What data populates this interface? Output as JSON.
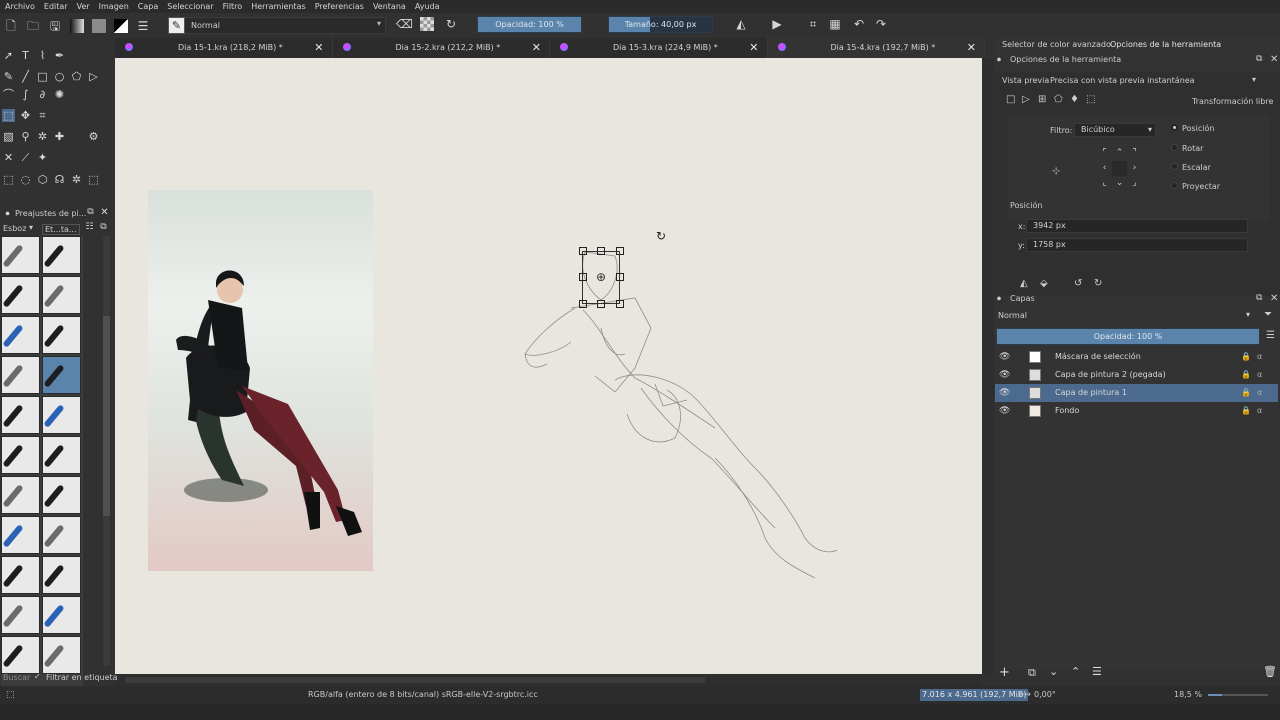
{
  "menu": [
    "Archivo",
    "Editar",
    "Ver",
    "Imagen",
    "Capa",
    "Seleccionar",
    "Filtro",
    "Herramientas",
    "Preferencias",
    "Ventana",
    "Ayuda"
  ],
  "toolbar": {
    "blend_mode": "Normal",
    "opacity_label": "Opacidad: 100 %",
    "opacity_value": 1.0,
    "size_label": "Tamaño: 40,00 px",
    "size_value": 0.4
  },
  "tabs": [
    {
      "title": "Dia 15-1.kra (218,2 MiB) *"
    },
    {
      "title": "Dia 15-2.kra (212,2 MiB) *"
    },
    {
      "title": "Dia 15-3.kra (224,9 MiB) *"
    },
    {
      "title": "Dia 15-4.kra (192,7 MiB) *"
    }
  ],
  "brush_presets": {
    "title": "Preajustes de pi...",
    "tag_value": "Esboz",
    "tag_label": "Et...ta...",
    "search_placeholder": "Buscar",
    "filter_label": "Filtrar en etiqueta"
  },
  "right": {
    "tab_color": "Selector de color avanzado",
    "tab_tool": "Opciones de la herramienta",
    "tool_options_title": "Opciones de la herramienta",
    "preview_label": "Vista previa",
    "preview_value": "Precisa con vista previa instantánea",
    "transform_mode": "Transformación libre",
    "filter_label": "Filtro:",
    "filter_value": "Bicúbico",
    "modes": [
      "Posición",
      "Rotar",
      "Escalar",
      "Proyectar"
    ],
    "position_section": "Posición",
    "x_label": "x:",
    "x_value": "3942 px",
    "y_label": "y:",
    "y_value": "1758 px"
  },
  "layers": {
    "title": "Capas",
    "blend": "Normal",
    "opacity_label": "Opacidad:  100 %",
    "items": [
      {
        "name": "Máscara de selección",
        "selected": false
      },
      {
        "name": "Capa de pintura 2 (pegada)",
        "selected": false
      },
      {
        "name": "Capa de pintura 1",
        "selected": true
      },
      {
        "name": "Fondo",
        "selected": false
      }
    ]
  },
  "status": {
    "color_space": "RGB/alfa (entero de 8 bits/canal)  sRGB-elle-V2-srgbtrc.icc",
    "image_size": "7.016 x 4.961 (192,7 MiB)",
    "rotation": "0,00°",
    "zoom": "18,5 %"
  },
  "colors": {
    "accent": "#4b6a8e",
    "slider": "#5b84ad",
    "canvas": "#e9e5df"
  }
}
